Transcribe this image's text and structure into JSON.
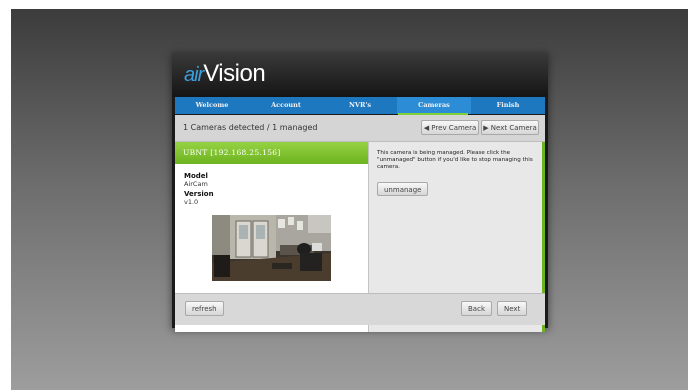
{
  "app": {
    "logo_prefix": "air",
    "logo_suffix": "Vision"
  },
  "steps": [
    {
      "label": "Welcome",
      "active": false
    },
    {
      "label": "Account",
      "active": false
    },
    {
      "label": "NVR's",
      "active": false
    },
    {
      "label": "Cameras",
      "active": true
    },
    {
      "label": "Finish",
      "active": false
    }
  ],
  "status": {
    "text": "1 Cameras detected / 1 managed",
    "prev_label": "◀ Prev Camera",
    "next_label": "▶ Next Camera"
  },
  "camera": {
    "header": "UBNT [192.168.25.156]",
    "model_label": "Model",
    "model_value": "AirCam",
    "version_label": "Version",
    "version_value": "v1.0"
  },
  "info": {
    "message": "This camera is being managed. Please click the \"unmanaged\" button if you'd like to stop managing this camera.",
    "unmanage_label": "unmanage"
  },
  "footer": {
    "refresh_label": "refresh",
    "back_label": "Back",
    "next_label": "Next"
  },
  "colors": {
    "accent_blue": "#1e78c0",
    "accent_green": "#6db31f"
  },
  "icons": [
    "prev-arrow-icon",
    "next-arrow-icon"
  ]
}
